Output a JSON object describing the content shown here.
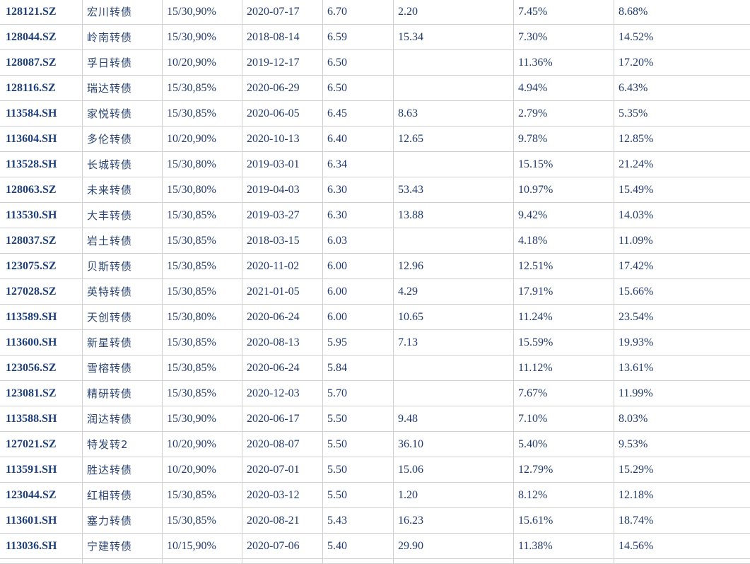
{
  "table": {
    "rows": [
      {
        "code": "128121.SZ",
        "name": "宏川转债",
        "terms": "15/30,90%",
        "date": "2020-07-17",
        "v1": "6.70",
        "v2": "2.20",
        "p1": "7.45%",
        "p2": "8.68%"
      },
      {
        "code": "128044.SZ",
        "name": "岭南转债",
        "terms": "15/30,90%",
        "date": "2018-08-14",
        "v1": "6.59",
        "v2": "15.34",
        "p1": "7.30%",
        "p2": "14.52%"
      },
      {
        "code": "128087.SZ",
        "name": "孚日转债",
        "terms": "10/20,90%",
        "date": "2019-12-17",
        "v1": "6.50",
        "v2": "",
        "p1": "11.36%",
        "p2": "17.20%"
      },
      {
        "code": "128116.SZ",
        "name": "瑞达转债",
        "terms": "15/30,85%",
        "date": "2020-06-29",
        "v1": "6.50",
        "v2": "",
        "p1": "4.94%",
        "p2": "6.43%"
      },
      {
        "code": "113584.SH",
        "name": "家悦转债",
        "terms": "15/30,85%",
        "date": "2020-06-05",
        "v1": "6.45",
        "v2": "8.63",
        "p1": "2.79%",
        "p2": "5.35%"
      },
      {
        "code": "113604.SH",
        "name": "多伦转债",
        "terms": "10/20,90%",
        "date": "2020-10-13",
        "v1": "6.40",
        "v2": "12.65",
        "p1": "9.78%",
        "p2": "12.85%"
      },
      {
        "code": "113528.SH",
        "name": "长城转债",
        "terms": "15/30,80%",
        "date": "2019-03-01",
        "v1": "6.34",
        "v2": "",
        "p1": "15.15%",
        "p2": "21.24%"
      },
      {
        "code": "128063.SZ",
        "name": "未来转债",
        "terms": "15/30,80%",
        "date": "2019-04-03",
        "v1": "6.30",
        "v2": "53.43",
        "p1": "10.97%",
        "p2": "15.49%"
      },
      {
        "code": "113530.SH",
        "name": "大丰转债",
        "terms": "15/30,85%",
        "date": "2019-03-27",
        "v1": "6.30",
        "v2": "13.88",
        "p1": "9.42%",
        "p2": "14.03%"
      },
      {
        "code": "128037.SZ",
        "name": "岩土转债",
        "terms": "15/30,85%",
        "date": "2018-03-15",
        "v1": "6.03",
        "v2": "",
        "p1": "4.18%",
        "p2": "11.09%"
      },
      {
        "code": "123075.SZ",
        "name": "贝斯转债",
        "terms": "15/30,85%",
        "date": "2020-11-02",
        "v1": "6.00",
        "v2": "12.96",
        "p1": "12.51%",
        "p2": "17.42%"
      },
      {
        "code": "127028.SZ",
        "name": "英特转债",
        "terms": "15/30,85%",
        "date": "2021-01-05",
        "v1": "6.00",
        "v2": "4.29",
        "p1": "17.91%",
        "p2": "15.66%"
      },
      {
        "code": "113589.SH",
        "name": "天创转债",
        "terms": "15/30,80%",
        "date": "2020-06-24",
        "v1": "6.00",
        "v2": "10.65",
        "p1": "11.24%",
        "p2": "23.54%"
      },
      {
        "code": "113600.SH",
        "name": "新星转债",
        "terms": "15/30,85%",
        "date": "2020-08-13",
        "v1": "5.95",
        "v2": "7.13",
        "p1": "15.59%",
        "p2": "19.93%"
      },
      {
        "code": "123056.SZ",
        "name": "雪榕转债",
        "terms": "15/30,85%",
        "date": "2020-06-24",
        "v1": "5.84",
        "v2": "",
        "p1": "11.12%",
        "p2": "13.61%"
      },
      {
        "code": "123081.SZ",
        "name": "精研转债",
        "terms": "15/30,85%",
        "date": "2020-12-03",
        "v1": "5.70",
        "v2": "",
        "p1": "7.67%",
        "p2": "11.99%"
      },
      {
        "code": "113588.SH",
        "name": "润达转债",
        "terms": "15/30,90%",
        "date": "2020-06-17",
        "v1": "5.50",
        "v2": "9.48",
        "p1": "7.10%",
        "p2": "8.03%"
      },
      {
        "code": "127021.SZ",
        "name": "特发转2",
        "terms": "10/20,90%",
        "date": "2020-08-07",
        "v1": "5.50",
        "v2": "36.10",
        "p1": "5.40%",
        "p2": "9.53%"
      },
      {
        "code": "113591.SH",
        "name": "胜达转债",
        "terms": "10/20,90%",
        "date": "2020-07-01",
        "v1": "5.50",
        "v2": "15.06",
        "p1": "12.79%",
        "p2": "15.29%"
      },
      {
        "code": "123044.SZ",
        "name": "红相转债",
        "terms": "15/30,85%",
        "date": "2020-03-12",
        "v1": "5.50",
        "v2": "1.20",
        "p1": "8.12%",
        "p2": "12.18%"
      },
      {
        "code": "113601.SH",
        "name": "塞力转债",
        "terms": "15/30,85%",
        "date": "2020-08-21",
        "v1": "5.43",
        "v2": "16.23",
        "p1": "15.61%",
        "p2": "18.74%"
      },
      {
        "code": "113036.SH",
        "name": "宁建转债",
        "terms": "10/15,90%",
        "date": "2020-07-06",
        "v1": "5.40",
        "v2": "29.90",
        "p1": "11.38%",
        "p2": "14.56%"
      }
    ]
  }
}
